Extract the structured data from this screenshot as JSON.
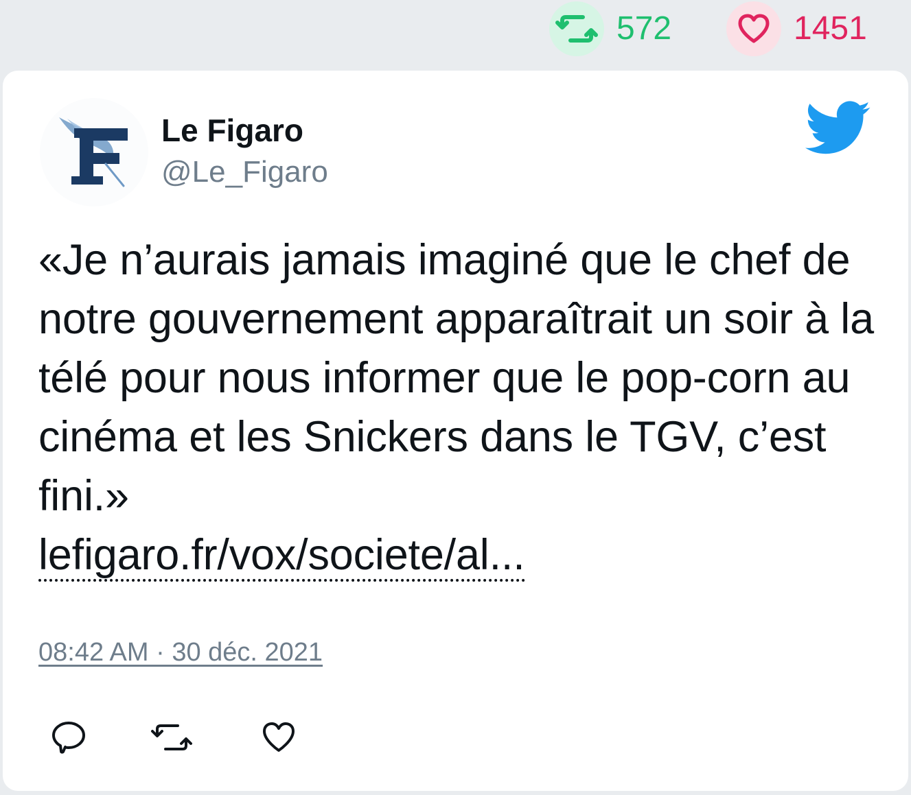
{
  "stats": {
    "retweets": "572",
    "likes": "1451",
    "retweet_icon": "retweet-icon",
    "like_icon": "heart-icon"
  },
  "tweet": {
    "author": {
      "name": "Le Figaro",
      "handle": "@Le_Figaro",
      "avatar_icon": "le-figaro-logo"
    },
    "platform_icon": "twitter-bird-icon",
    "text": "«Je n’aurais jamais imaginé que le chef de notre gouvernement apparaîtrait un soir à la télé pour nous informer que le pop-corn au cinéma et les Snickers dans le TGV, c’est fini.»",
    "link": "lefigaro.fr/vox/societe/al...",
    "timestamp": "08:42 AM · 30 déc. 2021",
    "actions": {
      "reply_icon": "reply-icon",
      "retweet_icon": "retweet-icon",
      "like_icon": "heart-icon"
    }
  },
  "colors": {
    "retweet_green": "#1fbf6f",
    "like_red": "#e0245e",
    "twitter_blue": "#1d9bf0",
    "figaro_navy": "#1b3a63",
    "muted_text": "#6e7d8b"
  }
}
